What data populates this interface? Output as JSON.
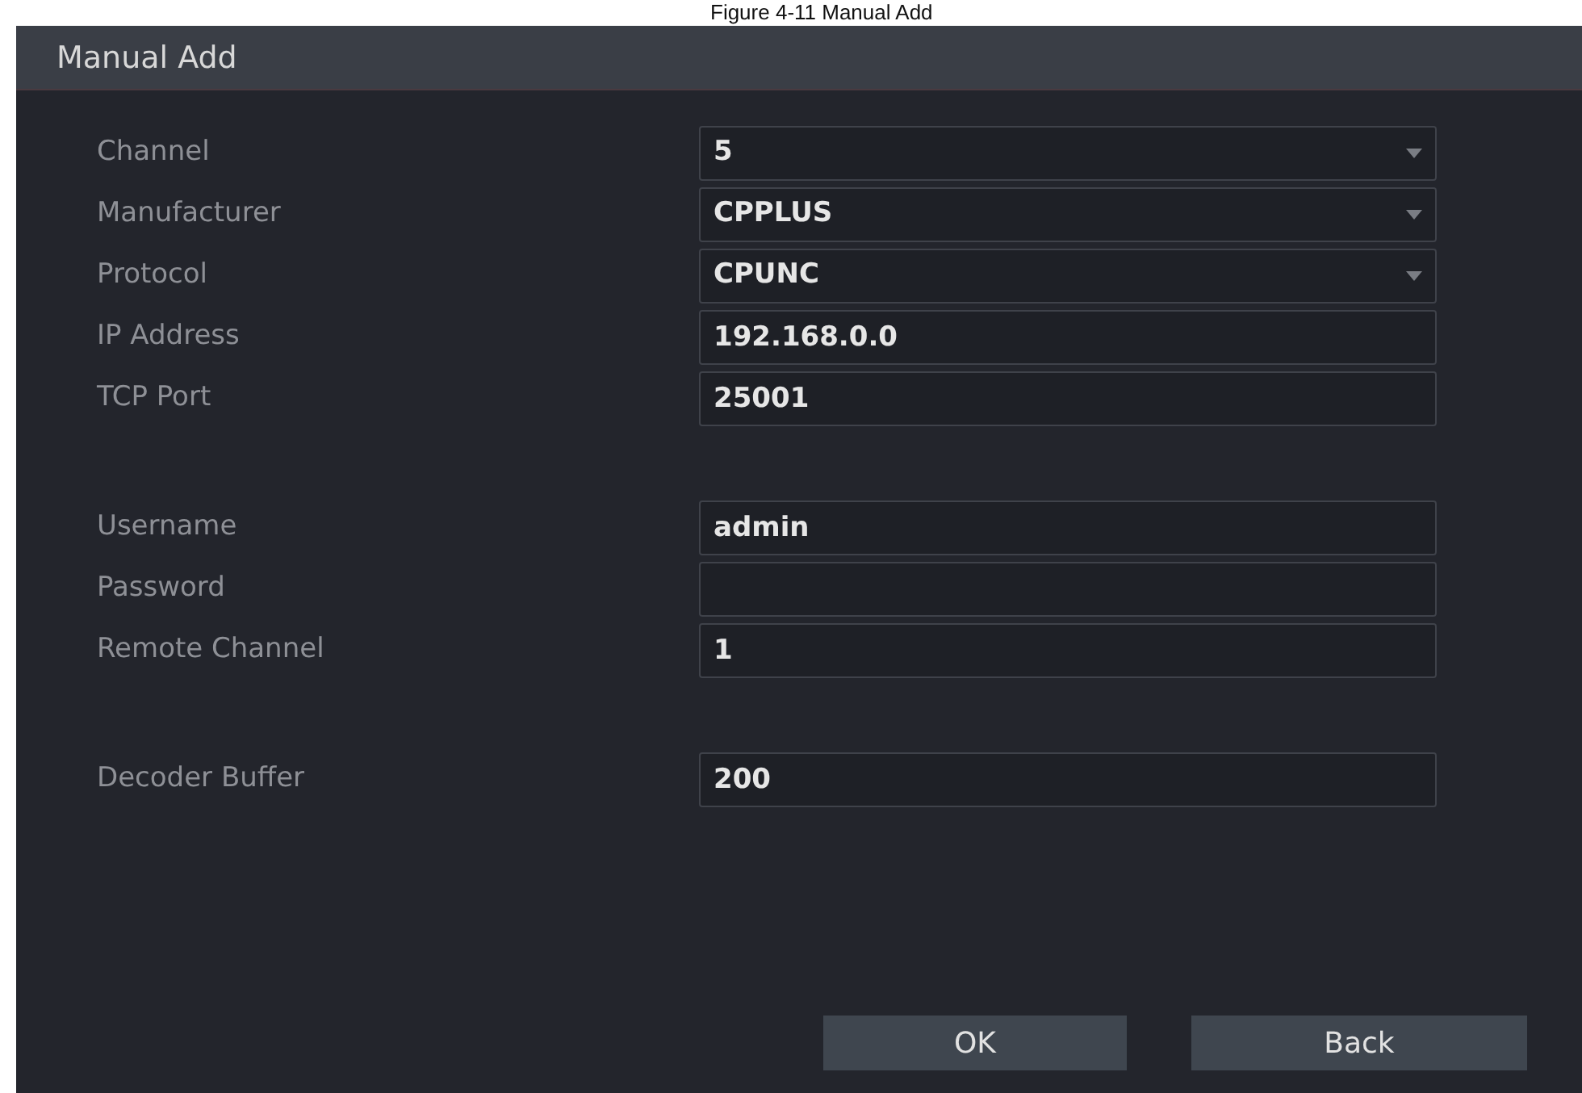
{
  "caption": "Figure 4-11 Manual Add",
  "window": {
    "title": "Manual Add"
  },
  "sections": [
    [
      {
        "label": "Channel",
        "kind": "select",
        "value": "5"
      },
      {
        "label": "Manufacturer",
        "kind": "select",
        "value": "CPPLUS"
      },
      {
        "label": "Protocol",
        "kind": "select",
        "value": "CPUNC"
      },
      {
        "label": "IP Address",
        "kind": "text",
        "value": "192.168.0.0"
      },
      {
        "label": "TCP Port",
        "kind": "text",
        "value": "25001"
      }
    ],
    [
      {
        "label": "Username",
        "kind": "text",
        "value": "admin"
      },
      {
        "label": "Password",
        "kind": "password"
      },
      {
        "label": "Remote Channel",
        "kind": "text",
        "value": "1"
      }
    ],
    [
      {
        "label": "Decoder Buffer",
        "kind": "text",
        "value": "200"
      }
    ]
  ],
  "buttons": [
    "OK",
    "Back"
  ]
}
